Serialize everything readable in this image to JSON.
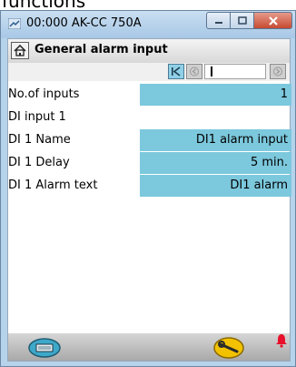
{
  "overlay": {
    "partial_text": "functions"
  },
  "window": {
    "title": "00:000 AK-CC 750A",
    "controls": {
      "minimize": "—",
      "maximize": "☐",
      "close": "✕"
    }
  },
  "page": {
    "title": "General alarm input"
  },
  "navigator": {
    "first": "|<",
    "prev": "<",
    "next": ">",
    "field_value": ""
  },
  "rows": [
    {
      "label": "No.of inputs",
      "value": "1"
    },
    {
      "label": "DI input 1",
      "value": ""
    },
    {
      "label": "DI 1 Name",
      "value": "DI1 alarm input"
    },
    {
      "label": "DI 1 Delay",
      "value": "5 min."
    },
    {
      "label": "DI 1 Alarm text",
      "value": "DI1 alarm"
    }
  ],
  "colors": {
    "window_frame": "#b6d3ec",
    "value_cell": "#7cc8dd",
    "alarm": "#e8102a",
    "tool_button": "#f2c200"
  },
  "icons": {
    "app": "plug-icon",
    "home": "home-icon",
    "device": "device-icon",
    "tool": "wrench-icon",
    "alarm": "alarm-bell-icon"
  }
}
